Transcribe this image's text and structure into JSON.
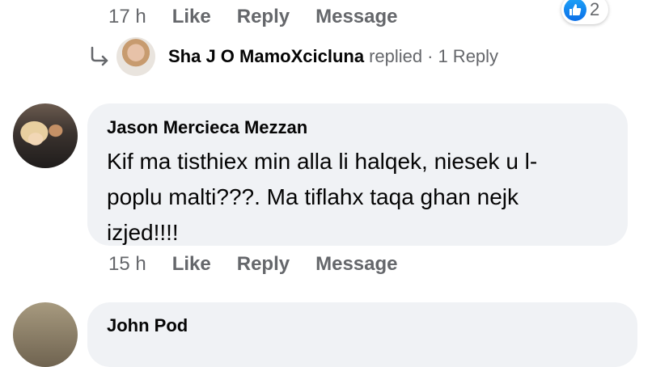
{
  "previous_comment": {
    "time": "17 h",
    "like_label": "Like",
    "reply_label": "Reply",
    "message_label": "Message",
    "reaction_count": "2",
    "reaction_icon": "like-icon"
  },
  "replies": {
    "name": "Sha J O MamoXcicluna",
    "verb": "replied",
    "separator": "·",
    "count_label": "1 Reply"
  },
  "comment": {
    "author": "Jason Mercieca Mezzan",
    "text": "Kif ma tisthiex min alla li halqek, niesek u l-poplu malti???. Ma tiflahx taqa ghan nejk izjed!!!!",
    "time": "15 h",
    "like_label": "Like",
    "reply_label": "Reply",
    "message_label": "Message"
  },
  "next_comment": {
    "author_partial": "John Pod"
  },
  "colors": {
    "bubble": "#f0f2f5",
    "meta_text": "#65676b",
    "primary_text": "#050505",
    "like_blue": "#1877f2"
  }
}
